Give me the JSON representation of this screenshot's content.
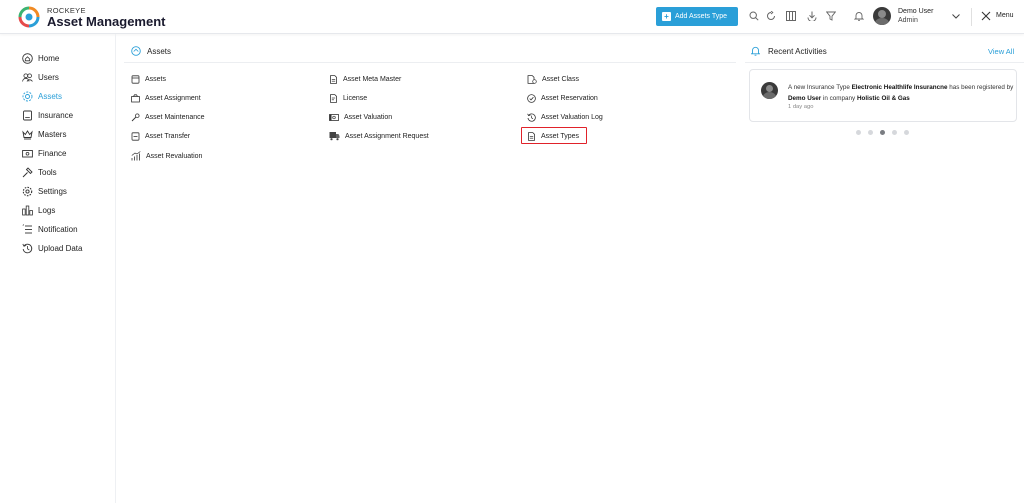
{
  "header": {
    "brand_small": "ROCKEYE",
    "brand_large": "Asset Management",
    "add_button_label": "Add Assets Type",
    "user_name": "Demo User",
    "user_role": "Admin",
    "menu_label": "Menu"
  },
  "sidebar": {
    "items": [
      {
        "label": "Home",
        "icon": "home-icon"
      },
      {
        "label": "Users",
        "icon": "users-icon"
      },
      {
        "label": "Assets",
        "icon": "assets-icon",
        "active": true
      },
      {
        "label": "Insurance",
        "icon": "insurance-icon"
      },
      {
        "label": "Masters",
        "icon": "crown-icon"
      },
      {
        "label": "Finance",
        "icon": "finance-icon"
      },
      {
        "label": "Tools",
        "icon": "tools-icon"
      },
      {
        "label": "Settings",
        "icon": "gear-icon"
      },
      {
        "label": "Logs",
        "icon": "logs-icon"
      },
      {
        "label": "Notification",
        "icon": "notification-icon"
      },
      {
        "label": "Upload Data",
        "icon": "upload-history-icon"
      }
    ]
  },
  "assets_panel": {
    "title": "Assets",
    "links": [
      {
        "label": "Assets"
      },
      {
        "label": "Asset Meta Master"
      },
      {
        "label": "Asset Class"
      },
      {
        "label": "Asset Assignment"
      },
      {
        "label": "License"
      },
      {
        "label": "Asset Reservation"
      },
      {
        "label": "Asset Maintenance"
      },
      {
        "label": "Asset Valuation"
      },
      {
        "label": "Asset Valuation Log"
      },
      {
        "label": "Asset Transfer"
      },
      {
        "label": "Asset Assignment Request"
      },
      {
        "label": "Asset Types",
        "highlighted": true
      },
      {
        "label": "Asset Revaluation"
      }
    ]
  },
  "recent_activities": {
    "title": "Recent Activities",
    "view_all": "View All",
    "item": {
      "t1": "A new Insurance Type ",
      "b1": "Electronic Healthlife Insurancne",
      "t2": " has been registered by ",
      "b2": "Demo User",
      "t3": " in company ",
      "b3": "Holistic Oil & Gas",
      "time": "1 day ago"
    },
    "carousel_active_index": 2,
    "carousel_count": 5
  },
  "colors": {
    "accent": "#2a9fd8",
    "highlight": "#e0222a"
  }
}
